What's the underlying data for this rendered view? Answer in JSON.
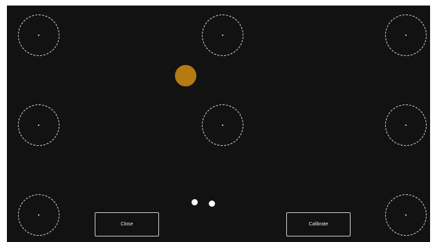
{
  "buttons": {
    "close_label": "Close",
    "calibrate_label": "Calibrate"
  },
  "colors": {
    "background": "#121212",
    "gaze_marker": "#b47a14",
    "target_outline": "#d8d8d8",
    "eye_marker": "#ffffff"
  },
  "icons": {
    "targets": "dashed-circle-target",
    "gaze": "filled-circle-gaze-marker",
    "eyes": "pupil-dot"
  }
}
